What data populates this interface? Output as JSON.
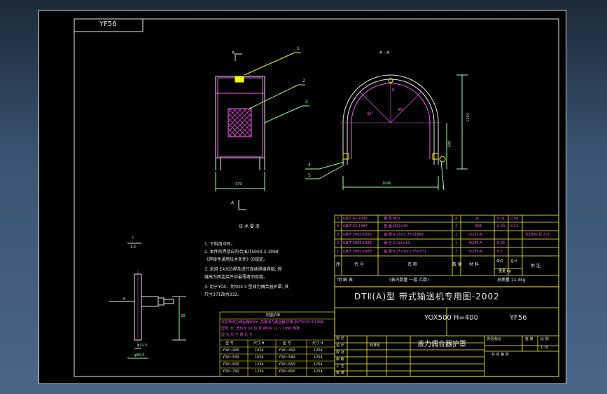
{
  "drawing": {
    "code_box": "YF56",
    "section_label": "A - A",
    "view_marker_top": "A",
    "view_marker_bottom": "A",
    "detail_label": "I",
    "detail_scale": "1:2",
    "part_numbers": [
      "1",
      "2",
      "3",
      "4",
      "5",
      "I"
    ],
    "dims": {
      "width_left": "370",
      "width_arc": "1690",
      "height_total": "1254",
      "height_lower": "600",
      "angle_1": "45°",
      "angle_2": "45°",
      "r_label": "R",
      "detail_d1": "φ31.5",
      "detail_d2": "φ60.5",
      "detail_h": "30",
      "detail_w": "8"
    },
    "tech_req_title": "技 术 要 求",
    "tech_req": [
      "1. 下料用冲压。",
      "2. 本件的焊接应符合JB/T5000.3-1998",
      "   《焊接件通用技术条件》的规定。",
      "3. 采用 E4303焊条进行连续焊缝焊接, 焊",
      "   缝高为两连接件中最薄者的厚度。",
      "4. 用于YOX、附YOX II 型液力偶合器护罩, 其",
      "   尺寸371改为332。"
    ]
  },
  "small_table": {
    "title": "附图护罩",
    "notes": [
      "本护罩液力偶合器YOXn, 高度液力偶合器 护罩 JB/T5000.3-1998",
      "型号, 长, 宽均为 XX 位 及 AYOX 11 ~ 1990 附录",
      "型 为 尺 寸 表 见 下"
    ],
    "headers": [
      "型 号",
      "尺寸 H",
      "型 号",
      "尺寸 H"
    ],
    "rows": [
      [
        "YOX~400",
        "1054",
        "YOX~450",
        "1254"
      ],
      [
        "YOX~500",
        "1054",
        "YOX~560",
        "1254"
      ],
      [
        "YOX~600",
        "1254",
        "YOX~650",
        "1254"
      ],
      [
        "YOX~750",
        "1254",
        "YOX~800",
        "1254"
      ]
    ]
  },
  "bom": {
    "rows": [
      {
        "no": "5",
        "code": "GB/T 41-2000",
        "name": "螺 母 M12",
        "qty": "4",
        "mat": "A",
        "unit": "0.01",
        "total": "0.04",
        "note": ""
      },
      {
        "no": "4",
        "code": "GB/T 93-1987",
        "name": "垫 圈 M12×30",
        "qty": "4",
        "mat": "35B",
        "unit": "0.03",
        "total": "0.12",
        "note": ""
      },
      {
        "no": "3",
        "code": "GB/T 3092-1993",
        "name": "扁 钢 b-25×2.75×1869",
        "qty": "2",
        "mat": "Q235-A",
        "unit": "",
        "total": "",
        "note": "长1800 长 371"
      },
      {
        "no": "2",
        "code": "GB/T 5805-1986",
        "name": "钢 丝 2×18×10",
        "qty": "1",
        "mat": "Q235-A",
        "unit": "0.35",
        "total": "",
        "note": ""
      },
      {
        "no": "1",
        "code": "GB/T 3092-1993",
        "name": "扁 钢 b-25×8×2.75×371",
        "qty": "2",
        "mat": "Q235-A",
        "unit": "0.5",
        "total": "",
        "note": ""
      }
    ],
    "header": {
      "no": "序",
      "code": "代 号",
      "name": "名 称",
      "qty": "数 量",
      "mat": "材 料",
      "unit": "单件",
      "total": "总计",
      "weight_unit": "重量 kg",
      "note": "附 注"
    },
    "footer_note": "明 细 表",
    "footer_sub": "(表内数量 一套 乙数)",
    "total_weight": "总质量 11.4kg"
  },
  "title_block": {
    "series": "DTⅡ(A)型 带式输送机专用图-2002",
    "spec": "YOX500 H=400",
    "code": "YF56",
    "name": "液力偶合器护罩",
    "rows_left": [
      "标 记",
      "设 计",
      "校 对",
      "审 核",
      "工 艺",
      "批 准"
    ],
    "stage": "阶段标记",
    "weight": "重 量",
    "ratio": "比 例",
    "scale": "1:10",
    "sheet": "共  张  第  张",
    "std": "标准化"
  }
}
